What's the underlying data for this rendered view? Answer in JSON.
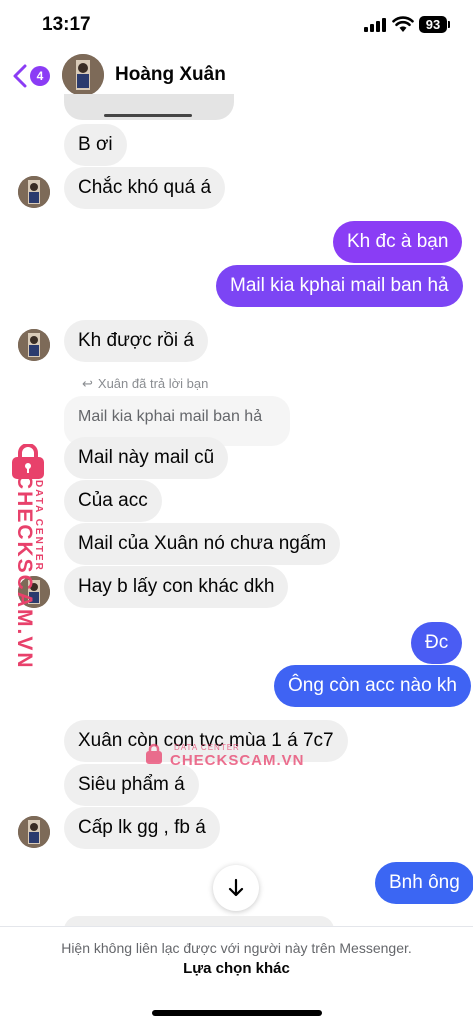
{
  "status_bar": {
    "time": "13:17",
    "battery": "93"
  },
  "header": {
    "back_count": "4",
    "contact_name": "Hoàng Xuân"
  },
  "colors": {
    "accent": "#8b3cf5",
    "out_purple": "#8a3df5",
    "out_blue": "#3f63f3",
    "incoming_bg": "#efefef",
    "watermark": "#e8416b"
  },
  "messages": [
    {
      "text": "B ơi",
      "direction": "in"
    },
    {
      "text": "Chắc khó quá á",
      "direction": "in"
    },
    {
      "text": "Kh đc à bạn",
      "direction": "out"
    },
    {
      "text": "Mail kia kphai mail ban hả",
      "direction": "out"
    },
    {
      "text": "Kh được rồi á",
      "direction": "in"
    },
    {
      "text": "Mail này mail cũ",
      "direction": "in"
    },
    {
      "text": "Của acc",
      "direction": "in"
    },
    {
      "text": "Mail của Xuân nó chưa ngấm",
      "direction": "in"
    },
    {
      "text": "Hay b lấy con khác dkh",
      "direction": "in"
    },
    {
      "text": "Đc",
      "direction": "out"
    },
    {
      "text": "Ông còn acc nào kh",
      "direction": "out"
    },
    {
      "text": "Xuân còn con tvc mùa 1 á 7c7",
      "direction": "in"
    },
    {
      "text": "Siêu phẩm á",
      "direction": "in"
    },
    {
      "text": "Cấp lk gg , fb á",
      "direction": "in"
    },
    {
      "text": "Bnh ông",
      "direction": "out"
    }
  ],
  "reply": {
    "label": "Xuân đã trả lời bạn",
    "quoted_text": "Mail kia kphai mail ban hả"
  },
  "watermark": {
    "brand": "CHECKSCAM.VN",
    "sub": "DATA CENTER"
  },
  "footer": {
    "notice": "Hiện không liên lạc được với người này trên Messenger.",
    "link": "Lựa chọn khác"
  },
  "icons": [
    "back-chevron-icon",
    "signal-icon",
    "wifi-icon",
    "battery-icon",
    "arrow-down-icon",
    "reply-arrow-icon",
    "lock-icon"
  ]
}
